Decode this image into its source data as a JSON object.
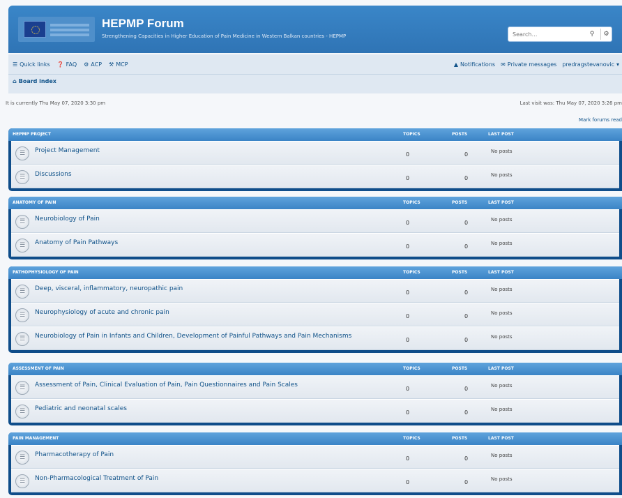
{
  "header": {
    "title": "HEPMP Forum",
    "description": "Strengthening Capacities in Higher Education of Pain Medicine in Western Balkan countries - HEPMP",
    "search_placeholder": "Search…",
    "search_icon": "search-icon",
    "advanced_search_icon": "gear-icon"
  },
  "nav": {
    "quick_links": "Quick links",
    "faq": "FAQ",
    "acp": "ACP",
    "mcp": "MCP",
    "notifications": "Notifications",
    "private_messages": "Private messages",
    "user": "predragstevanovic"
  },
  "breadcrumb": {
    "board_index": "Board index"
  },
  "info": {
    "current_time": "It is currently Thu May 07, 2020 3:30 pm",
    "last_visit": "Last visit was: Thu May 07, 2020 3:26 pm",
    "mark_read": "Mark forums read"
  },
  "columns": {
    "topics": "Topics",
    "posts": "Posts",
    "last_post": "Last post"
  },
  "categories": [
    {
      "name": "HEPMP Project",
      "forums": [
        {
          "name": "Project Management",
          "topics": "0",
          "posts": "0",
          "last_post": "No posts"
        },
        {
          "name": "Discussions",
          "topics": "0",
          "posts": "0",
          "last_post": "No posts"
        }
      ]
    },
    {
      "name": "Anatomy of Pain",
      "forums": [
        {
          "name": "Neurobiology of Pain",
          "topics": "0",
          "posts": "0",
          "last_post": "No posts"
        },
        {
          "name": "Anatomy of Pain Pathways",
          "topics": "0",
          "posts": "0",
          "last_post": "No posts"
        }
      ]
    },
    {
      "name": "Pathophysiology of Pain",
      "forums": [
        {
          "name": "Deep, visceral, inflammatory, neuropathic pain",
          "topics": "0",
          "posts": "0",
          "last_post": "No posts"
        },
        {
          "name": "Neurophysiology of acute and chronic pain",
          "topics": "0",
          "posts": "0",
          "last_post": "No posts"
        },
        {
          "name": "Neurobiology of Pain in Infants and Children, Development of Painful Pathways and Pain Mechanisms",
          "topics": "0",
          "posts": "0",
          "last_post": "No posts"
        }
      ]
    },
    {
      "name": "Assessment of Pain",
      "forums": [
        {
          "name": "Assessment of Pain, Clinical Evaluation of Pain, Pain Questionnaires and Pain Scales",
          "topics": "0",
          "posts": "0",
          "last_post": "No posts"
        },
        {
          "name": "Pediatric and neonatal scales",
          "topics": "0",
          "posts": "0",
          "last_post": "No posts"
        }
      ]
    },
    {
      "name": "Pain Management",
      "forums": [
        {
          "name": "Pharmacotherapy of Pain",
          "topics": "0",
          "posts": "0",
          "last_post": "No posts"
        },
        {
          "name": "Non-Pharmacological Treatment of Pain",
          "topics": "0",
          "posts": "0",
          "last_post": "No posts"
        }
      ]
    }
  ]
}
